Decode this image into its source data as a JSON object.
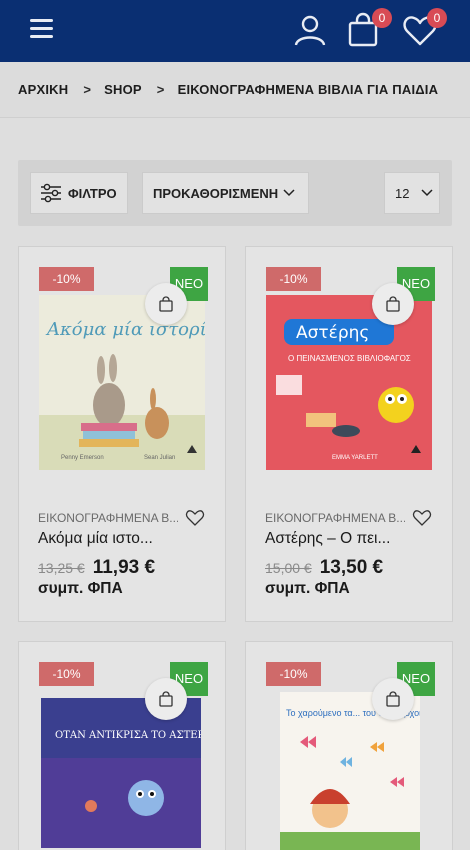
{
  "header": {
    "cart_count": "0",
    "wishlist_count": "0",
    "colors": {
      "bar": "#0a2f72",
      "badge": "#d84b55"
    }
  },
  "breadcrumb": {
    "home": "ΑΡΧΙΚΗ",
    "shop": "SHOP",
    "current": "ΕΙΚΟΝΟΓΡΑΦΗΜΕΝΑ ΒΙΒΛΙΑ ΓΙΑ ΠΑΙΔΙΑ"
  },
  "toolbar": {
    "filter_label": "ΦΙΛΤΡΟ",
    "sort_label": "ΠΡΟΚΑΘΟΡΙΣΜΕΝΗ",
    "per_page": "12"
  },
  "products": [
    {
      "discount": "-10%",
      "badge": "ΝΕΟ",
      "cover_title": "Ακόμα μία ιστορία",
      "cover_authors": [
        "Penny Emerson",
        "Sean Julian"
      ],
      "category": "ΕΙΚΟΝΟΓΡΑΦΗΜΕΝΑ Β...",
      "title": "Ακόμα μία ιστο...",
      "old_price": "13,25 €",
      "new_price": "11,93 €",
      "vat": "συμπ. ΦΠΑ"
    },
    {
      "discount": "-10%",
      "badge": "ΝΕΟ",
      "cover_title": "Αστέρης",
      "cover_subtitle": "Ο ΠΕΙΝΑΣΜΕΝΟΣ ΒΙΒΛΙΟΦΑΓΟΣ",
      "cover_authors": [
        "EMMA YARLETT"
      ],
      "category": "ΕΙΚΟΝΟΓΡΑΦΗΜΕΝΑ Β...",
      "title": "Αστέρης – Ο πει...",
      "old_price": "15,00 €",
      "new_price": "13,50 €",
      "vat": "συμπ. ΦΠΑ"
    },
    {
      "discount": "-10%",
      "badge": "ΝΕΟ",
      "cover_title": "ΟΤΑΝ ΑΝΤΙΚΡΙΣΑ ΤΟ ΑΣΤΕΡΙ ΜΟΥ"
    },
    {
      "discount": "-10%",
      "badge": "ΝΕΟ",
      "cover_title": "Το χαρούμενο τα... του σκαντζόχοιρου"
    }
  ]
}
